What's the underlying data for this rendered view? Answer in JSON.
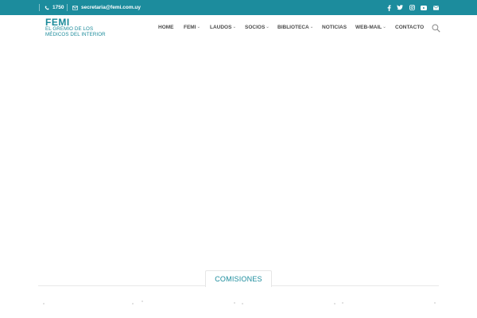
{
  "colors": {
    "brand": "#1c8c9d",
    "nav_text": "#4a4a4a"
  },
  "topbar": {
    "phone": {
      "icon": "phone-icon",
      "text": "1750"
    },
    "email": {
      "icon": "envelope-icon",
      "text": "secretaria@femi.com.uy"
    },
    "social": [
      "facebook-icon",
      "twitter-icon",
      "instagram-icon",
      "youtube-icon",
      "mail-icon"
    ]
  },
  "logo": {
    "name": "FEMI",
    "line1": "EL GREMIO DE LOS",
    "line2": "MÉDICOS DEL INTERIOR"
  },
  "nav": {
    "items": [
      {
        "label": "HOME",
        "dropdown": false
      },
      {
        "label": "FEMI",
        "dropdown": true
      },
      {
        "label": "LAUDOS",
        "dropdown": true
      },
      {
        "label": "SOCIOS",
        "dropdown": true
      },
      {
        "label": "BIBLIOTECA",
        "dropdown": true
      },
      {
        "label": "NOTICIAS",
        "dropdown": false
      },
      {
        "label": "WEB-MAIL",
        "dropdown": true
      },
      {
        "label": "CONTACTO",
        "dropdown": false
      }
    ],
    "search_icon": "search-icon"
  },
  "section": {
    "tab_label": "COMISIONES"
  }
}
